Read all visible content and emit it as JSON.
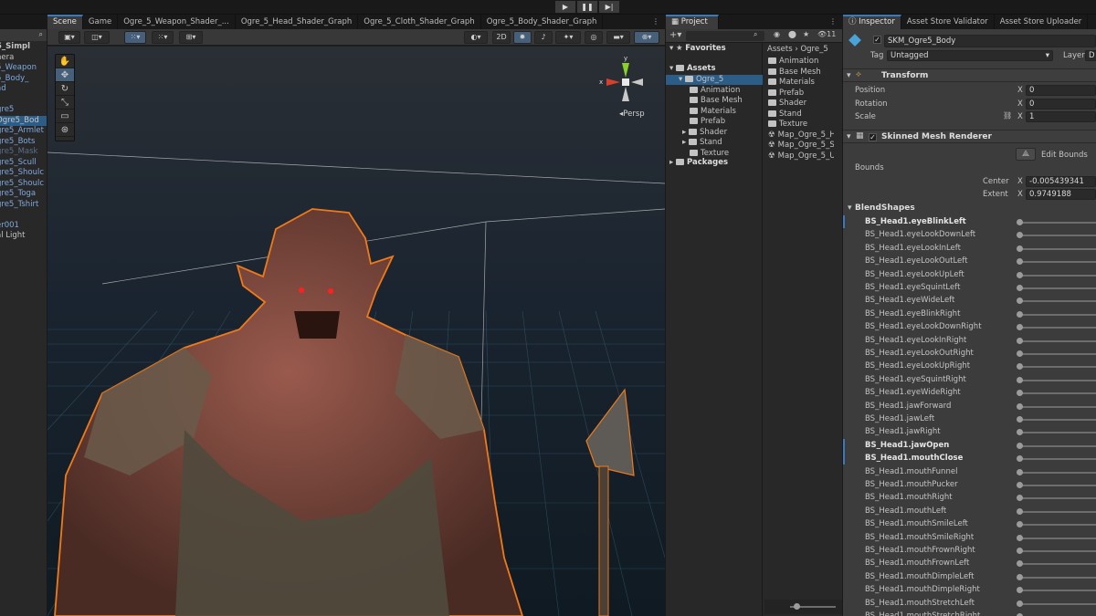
{
  "playbar": {
    "play": "▶",
    "pause": "❚❚",
    "step": "▶|"
  },
  "hierarchy": {
    "rows": [
      {
        "text": "5_Simpl",
        "color": "#c4c4c4",
        "bold": true
      },
      {
        "text": "nera",
        "color": "#c4c4c4"
      },
      {
        "text": "5_Weapon",
        "color": "#7fa9e0"
      },
      {
        "text": "5_Body_",
        "color": "#7fa9e0"
      },
      {
        "text": "ad",
        "color": "#7fa9e0"
      },
      {
        "text": "",
        "color": "#c4c4c4"
      },
      {
        "text": "gre5",
        "color": "#7fa9e0"
      },
      {
        "text": "Ogre5_Bod",
        "color": "#c4c4c4"
      },
      {
        "text": "gre5_Armlet",
        "color": "#7fa9e0"
      },
      {
        "text": "gre5_Bots",
        "color": "#7fa9e0"
      },
      {
        "text": "gre5_Mask",
        "color": "#5b6e8c"
      },
      {
        "text": "gre5_Scull",
        "color": "#7fa9e0"
      },
      {
        "text": "gre5_Shoulc",
        "color": "#7fa9e0"
      },
      {
        "text": "gre5_Shoulc",
        "color": "#7fa9e0"
      },
      {
        "text": "gre5_Toga",
        "color": "#7fa9e0"
      },
      {
        "text": "gre5_Tshirt",
        "color": "#7fa9e0"
      },
      {
        "text": "",
        "color": "#c4c4c4"
      },
      {
        "text": "er001",
        "color": "#7fa9e0"
      },
      {
        "text": "al Light",
        "color": "#c4c4c4"
      }
    ]
  },
  "scene": {
    "tabs": [
      "Scene",
      "Game",
      "Ogre_5_Weapon_Shader_...",
      "Ogre_5_Head_Shader_Graph",
      "Ogre_5_Cloth_Shader_Graph",
      "Ogre_5_Body_Shader_Graph"
    ],
    "mode2d": "2D",
    "persp": "◂Persp",
    "gizmo": {
      "x": "x",
      "y": "y"
    }
  },
  "project": {
    "tab": "Project",
    "favorites": "Favorites",
    "assets": "Assets",
    "tree": [
      "Ogre_5",
      "Animation",
      "Base Mesh",
      "Materials",
      "Prefab",
      "Shader",
      "Stand",
      "Texture"
    ],
    "packages": "Packages",
    "breadcrumb": "Assets  ›  Ogre_5",
    "count": "11",
    "files": [
      "Animation",
      "Base Mesh",
      "Materials",
      "Prefab",
      "Shader",
      "Stand",
      "Texture",
      "Map_Ogre_5_H",
      "Map_Ogre_5_S",
      "Map_Ogre_5_U"
    ]
  },
  "inspector": {
    "tabs": [
      "Inspector",
      "Asset Store Validator",
      "Asset Store Uploader"
    ],
    "object_name": "SKM_Ogre5_Body",
    "tag_label": "Tag",
    "tag_value": "Untagged",
    "layer_label": "Layer",
    "layer_value": "D",
    "transform": {
      "title": "Transform",
      "position_label": "Position",
      "position_x": "0",
      "rotation_label": "Rotation",
      "rotation_x": "0",
      "scale_label": "Scale",
      "scale_x": "1",
      "x_label": "X"
    },
    "smr": {
      "title": "Skinned Mesh Renderer",
      "edit_bounds": "Edit Bounds",
      "bounds": "Bounds",
      "center_label": "Center",
      "center_x": "-0.005439341",
      "extent_label": "Extent",
      "extent_x": "0.9749188"
    },
    "blendshapes_title": "BlendShapes",
    "blendshapes": [
      {
        "name": "BS_Head1.eyeBlinkLeft",
        "bold": true
      },
      {
        "name": "BS_Head1.eyeLookDownLeft",
        "bold": false
      },
      {
        "name": "BS_Head1.eyeLookInLeft",
        "bold": false
      },
      {
        "name": "BS_Head1.eyeLookOutLeft",
        "bold": false
      },
      {
        "name": "BS_Head1.eyeLookUpLeft",
        "bold": false
      },
      {
        "name": "BS_Head1.eyeSquintLeft",
        "bold": false
      },
      {
        "name": "BS_Head1.eyeWideLeft",
        "bold": false
      },
      {
        "name": "BS_Head1.eyeBlinkRight",
        "bold": false
      },
      {
        "name": "BS_Head1.eyeLookDownRight",
        "bold": false
      },
      {
        "name": "BS_Head1.eyeLookInRight",
        "bold": false
      },
      {
        "name": "BS_Head1.eyeLookOutRight",
        "bold": false
      },
      {
        "name": "BS_Head1.eyeLookUpRight",
        "bold": false
      },
      {
        "name": "BS_Head1.eyeSquintRight",
        "bold": false
      },
      {
        "name": "BS_Head1.eyeWideRight",
        "bold": false
      },
      {
        "name": "BS_Head1.jawForward",
        "bold": false
      },
      {
        "name": "BS_Head1.jawLeft",
        "bold": false
      },
      {
        "name": "BS_Head1.jawRight",
        "bold": false
      },
      {
        "name": "BS_Head1.jawOpen",
        "bold": true
      },
      {
        "name": "BS_Head1.mouthClose",
        "bold": true
      },
      {
        "name": "BS_Head1.mouthFunnel",
        "bold": false
      },
      {
        "name": "BS_Head1.mouthPucker",
        "bold": false
      },
      {
        "name": "BS_Head1.mouthRight",
        "bold": false
      },
      {
        "name": "BS_Head1.mouthLeft",
        "bold": false
      },
      {
        "name": "BS_Head1.mouthSmileLeft",
        "bold": false
      },
      {
        "name": "BS_Head1.mouthSmileRight",
        "bold": false
      },
      {
        "name": "BS_Head1.mouthFrownRight",
        "bold": false
      },
      {
        "name": "BS_Head1.mouthFrownLeft",
        "bold": false
      },
      {
        "name": "BS_Head1.mouthDimpleLeft",
        "bold": false
      },
      {
        "name": "BS_Head1.mouthDimpleRight",
        "bold": false
      },
      {
        "name": "BS_Head1.mouthStretchLeft",
        "bold": false
      },
      {
        "name": "BS_Head1.mouthStretchRight",
        "bold": false
      }
    ]
  }
}
